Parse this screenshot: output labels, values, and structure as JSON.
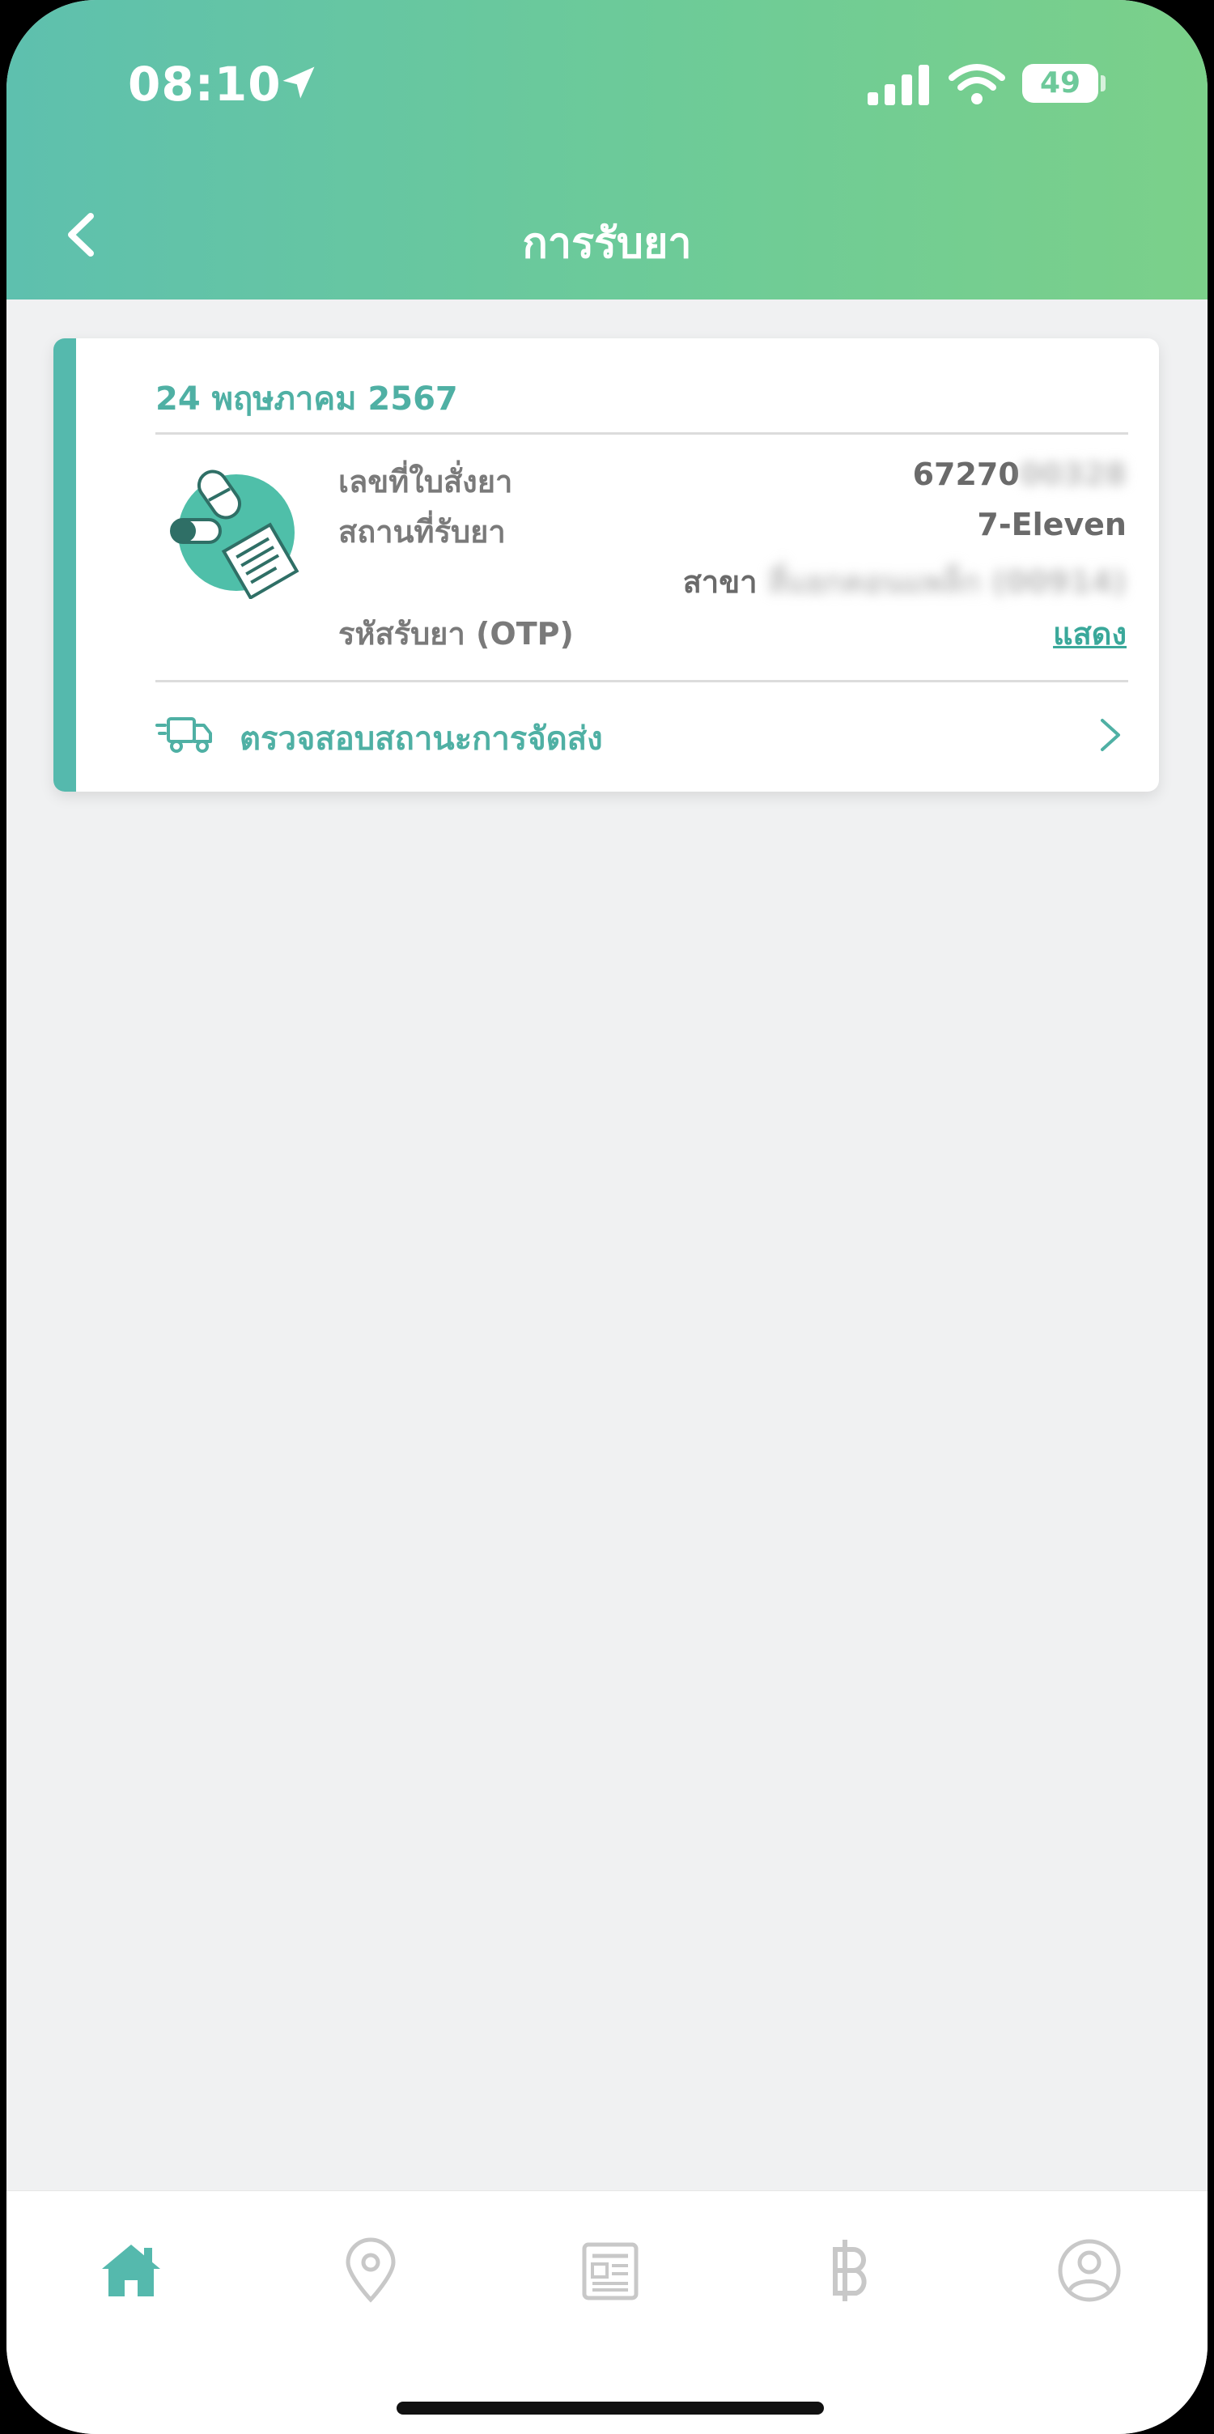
{
  "status_bar": {
    "time": "08:10",
    "battery": "49"
  },
  "header": {
    "title": "การรับยา"
  },
  "card": {
    "date": "24 พฤษภาคม 2567",
    "rows": {
      "prescription_label": "เลขที่ใบสั่งยา",
      "prescription_value": "67270",
      "prescription_blurred": "00328",
      "pickup_label": "สถานที่รับยา",
      "pickup_value": "7-Eleven",
      "branch_label": "สาขา",
      "branch_blurred": "สี่แยกคอนแพล็ก (00914)",
      "otp_label": "รหัสรับยา (OTP)",
      "otp_action": "แสดง"
    },
    "status_link": "ตรวจสอบสถานะการจัดส่ง"
  },
  "bottom_nav": {
    "items": [
      {
        "icon": "home-icon",
        "active": true
      },
      {
        "icon": "location-pin-icon",
        "active": false
      },
      {
        "icon": "news-icon",
        "active": false
      },
      {
        "icon": "baht-icon",
        "active": false
      },
      {
        "icon": "profile-icon",
        "active": false
      }
    ]
  },
  "colors": {
    "accent": "#4fb0a4",
    "header_start": "#5ec0ae",
    "header_end": "#7bd08a",
    "inactive_icon": "#c8c8c8"
  }
}
